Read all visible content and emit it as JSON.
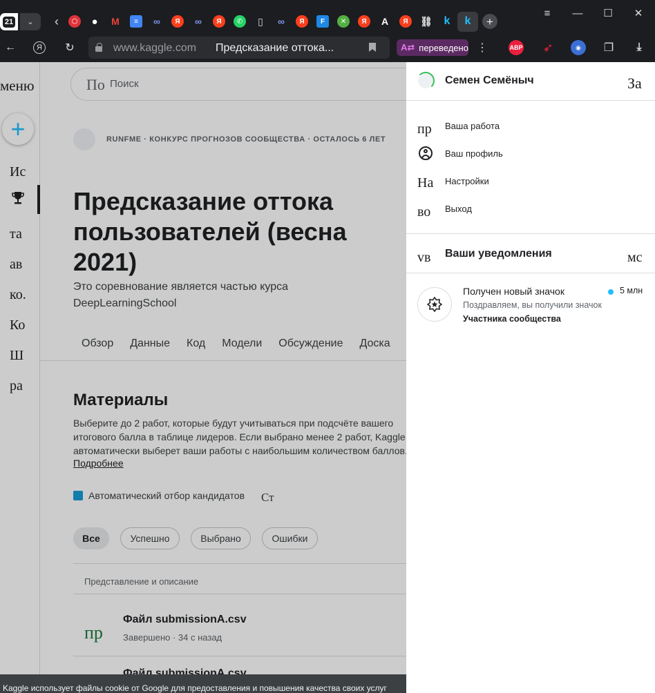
{
  "browser": {
    "tab_count": "21",
    "address": {
      "domain": "www.kaggle.com",
      "title": "Предсказание оттока..."
    },
    "translate_label": "переведено",
    "abp_label": "ABP",
    "favicons": [
      {
        "icon": "red-shield-icon",
        "color": "#e0323b"
      },
      {
        "icon": "github-icon",
        "color": "#ffffff"
      },
      {
        "icon": "gmail-icon",
        "color": "#ea4335"
      },
      {
        "icon": "docs-icon",
        "color": "#4285f4"
      },
      {
        "icon": "link-icon",
        "color": "#5b7bd8"
      },
      {
        "icon": "yandex-icon",
        "color": "#fc3f1d"
      },
      {
        "icon": "link-icon",
        "color": "#5b7bd8"
      },
      {
        "icon": "yandex-icon",
        "color": "#fc3f1d"
      },
      {
        "icon": "whatsapp-icon",
        "color": "#25d366"
      },
      {
        "icon": "file-icon",
        "color": "#dddddd"
      },
      {
        "icon": "link-icon",
        "color": "#5b7bd8"
      },
      {
        "icon": "yandex-icon",
        "color": "#fc3f1d"
      },
      {
        "icon": "f-icon",
        "color": "#1e88e5"
      },
      {
        "icon": "xbox-icon",
        "color": "#52b043"
      },
      {
        "icon": "yandex-icon",
        "color": "#fc3f1d"
      },
      {
        "icon": "a-icon",
        "color": "#ffffff"
      },
      {
        "icon": "yandex-icon",
        "color": "#fc3f1d"
      },
      {
        "icon": "chain-icon",
        "color": "#dddddd"
      },
      {
        "icon": "kaggle-icon",
        "color": "#20beff"
      },
      {
        "icon": "kaggle-icon",
        "color": "#20beff"
      }
    ]
  },
  "nav": {
    "menu_text": "меню",
    "fragments": [
      "Ис",
      "та",
      "ав",
      "ко.",
      "Ко",
      "Ш",
      "ра"
    ]
  },
  "search": {
    "fragment": "По",
    "placeholder": "Поиск"
  },
  "competition": {
    "meta": "RUNFME · КОНКУРС ПРОГНОЗОВ СООБЩЕСТВА · ОСТАЛОСЬ 6 ЛЕТ",
    "title": "Предсказание оттока пользователей (весна 2021)",
    "subtitle": "Это соревнование является частью курса DeepLearningSchool",
    "tabs": [
      "Обзор",
      "Данные",
      "Код",
      "Модели",
      "Обсуждение",
      "Доска"
    ]
  },
  "materials": {
    "title": "Материалы",
    "description": "Выберите до 2 работ, которые будут учитываться при подсчёте вашего итогового балла в таблице лидеров. Если выбрано менее 2 работ, Kaggle автоматически выберет ваши работы с наибольшим количеством баллов.",
    "more_link": "Подробнее",
    "auto_select_label": "Автоматический отбор кандидатов",
    "auto_select_fragment": "Ст",
    "filters": [
      "Все",
      "Успешно",
      "Выбрано",
      "Ошибки"
    ],
    "table_header": "Представление и описание",
    "rows": [
      {
        "icon_text": "пр",
        "name": "Файл submissionA.csv",
        "status": "Завершено · 34 с назад"
      },
      {
        "name": "Файл submissionA.csv"
      }
    ]
  },
  "cookie_text": "Kaggle использует файлы cookie от Google для предоставления и повышения качества своих услуг",
  "panel": {
    "user_name": "Семен Семёныч",
    "user_fragment": "За",
    "menu": [
      {
        "frag": "пр",
        "label": "Ваша работа"
      },
      {
        "label": "Ваш профиль"
      },
      {
        "frag": "На",
        "label": "Настройки"
      },
      {
        "frag": "во",
        "label": "Выход"
      }
    ],
    "notifications_frag": "vв",
    "notifications_title": "Ваши уведомления",
    "notifications_right_frag": "мс",
    "notification": {
      "title": "Получен новый значок",
      "body_prefix": "Поздравляем, вы получили значок ",
      "body_bold": "Участника сообщества",
      "time": "5 млн"
    }
  },
  "colors": {
    "accent": "#20beff",
    "checkbox": "#1a9cd8",
    "translate_pill": "#5c2a62"
  }
}
